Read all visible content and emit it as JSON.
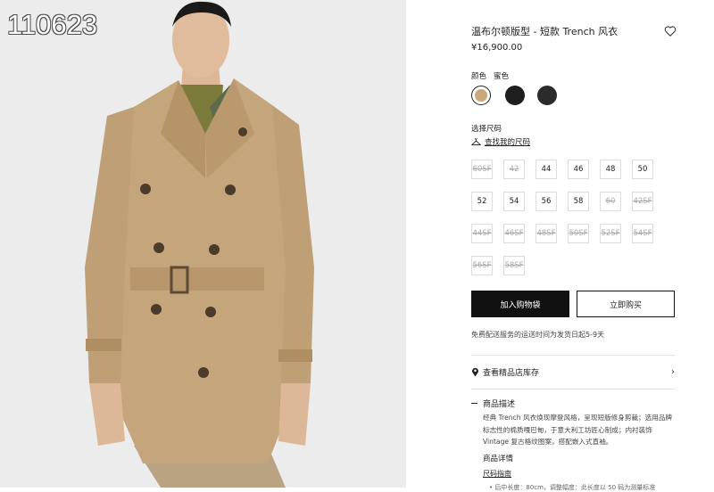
{
  "watermark": "110623",
  "product": {
    "title": "温布尔顿版型 - 短款 Trench 风衣",
    "price": "¥16,900.00"
  },
  "colors": {
    "label": "颜色",
    "value": "蜜色",
    "swatches": [
      {
        "name": "蜜色",
        "hex": "#c9a87a",
        "selected": true
      },
      {
        "name": "黑色",
        "hex": "#1e1e1e",
        "selected": false
      },
      {
        "name": "深灰",
        "hex": "#2b2b2b",
        "selected": false
      }
    ]
  },
  "size": {
    "label": "选择尺码",
    "guide": "查找我的尺码",
    "options": [
      {
        "label": "60SF",
        "available": false
      },
      {
        "label": "42",
        "available": false
      },
      {
        "label": "44",
        "available": true
      },
      {
        "label": "46",
        "available": true
      },
      {
        "label": "48",
        "available": true
      },
      {
        "label": "50",
        "available": true
      },
      {
        "label": "52",
        "available": true
      },
      {
        "label": "54",
        "available": true
      },
      {
        "label": "56",
        "available": true
      },
      {
        "label": "58",
        "available": true
      },
      {
        "label": "60",
        "available": false
      },
      {
        "label": "42SF",
        "available": false
      },
      {
        "label": "44SF",
        "available": false
      },
      {
        "label": "46SF",
        "available": false
      },
      {
        "label": "48SF",
        "available": false
      },
      {
        "label": "50SF",
        "available": false
      },
      {
        "label": "52SF",
        "available": false
      },
      {
        "label": "54SF",
        "available": false
      },
      {
        "label": "56SF",
        "available": false
      },
      {
        "label": "58SF",
        "available": false
      }
    ]
  },
  "actions": {
    "add_to_bag": "加入购物袋",
    "buy_now": "立即购买"
  },
  "shipping_note": "免费配送服务的运送时间为发货日起5-9天",
  "store": {
    "label": "查看精品店库存",
    "icon": "location-pin-icon"
  },
  "description": {
    "heading": "商品描述",
    "body": "经典 Trench 风衣焕现摩登风格，呈现短版修身剪裁；选用品牌标志性的棉质嘎巴甸，于意大利工坊匠心制成；内衬装饰 Vintage 复古格纹图案，搭配嵌入式直袖。"
  },
  "details": {
    "heading": "商品详情",
    "size_guide": "尺码指南",
    "bullet": "• 后中长度：80cm，调整幅度：此长度以 50 码为测量标准"
  },
  "accent": {
    "black": "#111111",
    "disabled": "#aaaaaa",
    "coat": "#c2a27a"
  }
}
